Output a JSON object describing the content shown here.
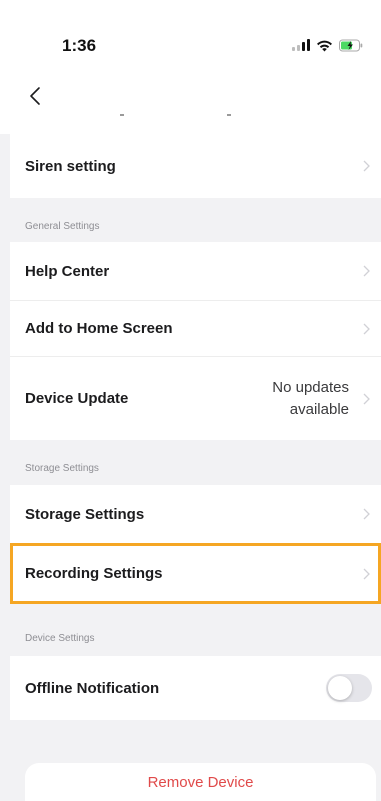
{
  "status_bar": {
    "time": "1:36"
  },
  "nav": {
    "back_icon": "chevron-left-icon"
  },
  "rows": {
    "siren_setting": "Siren setting",
    "help_center": "Help Center",
    "add_to_home_screen": "Add to Home Screen",
    "device_update": "Device Update",
    "device_update_value_line1": "No updates",
    "device_update_value_line2": "available",
    "storage_settings": "Storage Settings",
    "recording_settings": "Recording Settings",
    "offline_notification": "Offline Notification"
  },
  "sections": {
    "general": "General Settings",
    "storage": "Storage Settings",
    "device": "Device Settings"
  },
  "toggles": {
    "offline_notification_on": false
  },
  "remove_button": {
    "label": "Remove Device"
  },
  "colors": {
    "highlight": "#f5a623",
    "destructive": "#e04a4a",
    "background": "#f2f2f4"
  }
}
